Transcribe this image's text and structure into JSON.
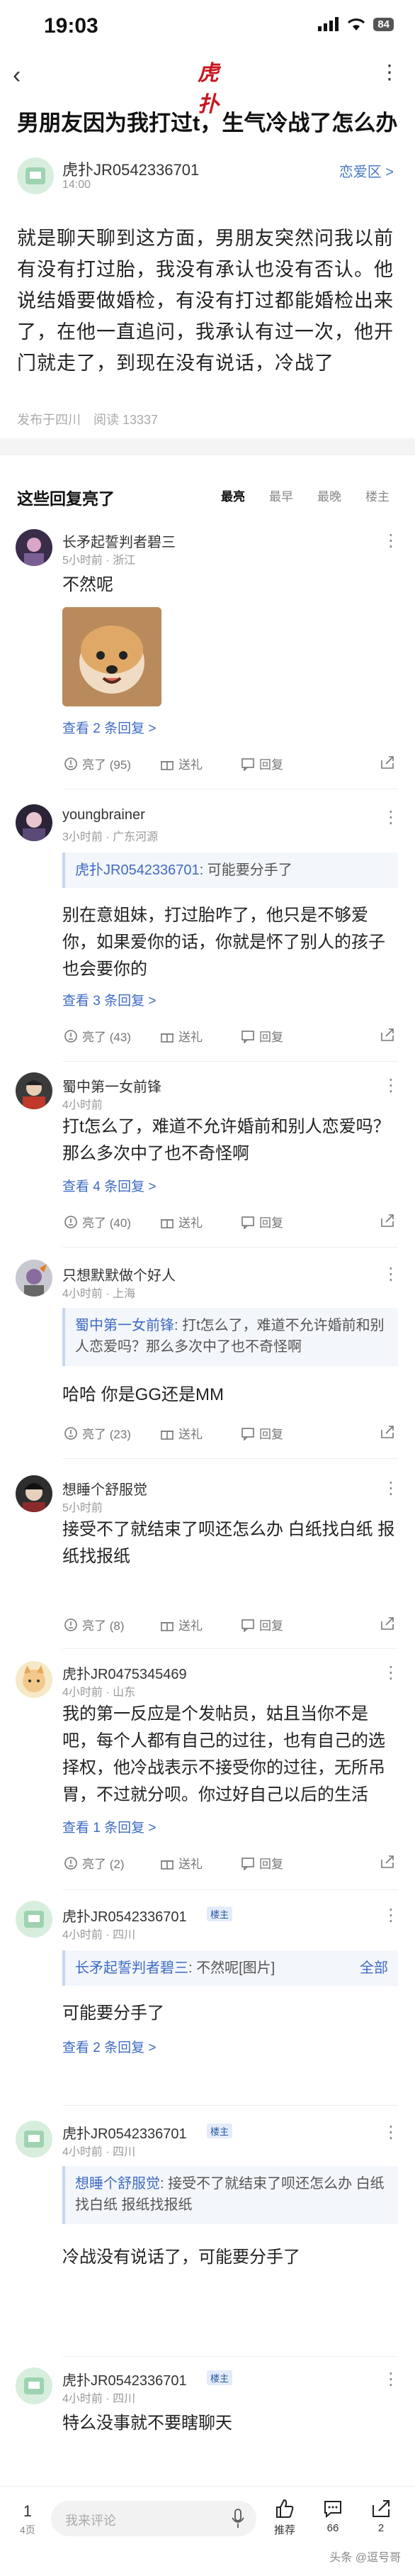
{
  "status_bar": {
    "time": "19:03",
    "battery": "84"
  },
  "nav": {
    "back_glyph": "‹",
    "logo_text": "虎扑",
    "more_glyph": "⋮",
    "brand_color": "#c8161d"
  },
  "post": {
    "title": "男朋友因为我打过t，生气冷战了怎么办",
    "author": "虎扑JR0542336701",
    "time": "14:00",
    "board": "恋爱区 >",
    "body": "就是聊天聊到这方面，男朋友突然问我以前有没有打过胎，我没有承认也没有否认。他说结婚要做婚检，有没有打过都能婚检出来了，在他一直追问，我承认有过一次，他开门就走了，到现在没有说话，冷战了",
    "meta": "发布于四川　阅读 13337"
  },
  "replies": {
    "section_title": "这些回复亮了",
    "sort": [
      "最亮",
      "最早",
      "最晚",
      "楼主"
    ]
  },
  "comments": [
    {
      "name": "长矛起誓判者碧三",
      "meta": "5小时前 · 浙江",
      "text": "不然呢",
      "link": "查看 2 条回复 >",
      "light": "亮了 (95)",
      "gift": "送礼",
      "reply": "回复"
    },
    {
      "name": "youngbrainer",
      "meta": "3小时前 · 广东河源",
      "quote_name": "虎扑JR0542336701",
      "quote_text": ": 可能要分手了",
      "text": "别在意姐妹，打过胎咋了，他只是不够爱你，如果爱你的话，你就是怀了别人的孩子也会要你的",
      "link": "查看 3 条回复 >",
      "light": "亮了 (43)",
      "gift": "送礼",
      "reply": "回复"
    },
    {
      "name": "蜀中第一女前锋",
      "meta": "4小时前",
      "text": "打t怎么了，难道不允许婚前和别人恋爱吗？那么多次中了也不奇怪啊",
      "link": "查看 4 条回复 >",
      "light": "亮了 (40)",
      "gift": "送礼",
      "reply": "回复"
    },
    {
      "name": "只想默默做个好人",
      "meta": "4小时前 · 上海",
      "quote_name": "蜀中第一女前锋",
      "quote_text": ": 打t怎么了，难道不允许婚前和别人恋爱吗？那么多次中了也不奇怪啊",
      "text": "哈哈 你是GG还是MM",
      "light": "亮了 (23)",
      "gift": "送礼",
      "reply": "回复"
    },
    {
      "name": "想睡个舒服觉",
      "meta": "5小时前",
      "text": "接受不了就结束了呗还怎么办 白纸找白纸 报纸找报纸",
      "light": "亮了 (8)",
      "gift": "送礼",
      "reply": "回复"
    },
    {
      "name": "虎扑JR0475345469",
      "meta": "4小时前 · 山东",
      "text": "我的第一反应是个发帖员，姑且当你不是吧，每个人都有自己的过往，也有自己的选择权，他冷战表示不接受你的过往，无所吊胃，不过就分呗。你过好自己以后的生活",
      "link": "查看 1 条回复 >",
      "light": "亮了 (2)",
      "gift": "送礼",
      "reply": "回复"
    },
    {
      "name": "虎扑JR0542336701",
      "badge": "楼主",
      "meta": "4小时前 · 四川",
      "quote_name": "长矛起誓判者碧三",
      "quote_text": ": 不然呢[图片]",
      "quote_all": "全部",
      "text": "可能要分手了",
      "link": "查看 2 条回复 >"
    },
    {
      "name": "虎扑JR0542336701",
      "badge": "楼主",
      "meta": "4小时前 · 四川",
      "quote_name": "想睡个舒服觉",
      "quote_text": ": 接受不了就结束了呗还怎么办 白纸找白纸 报纸找报纸",
      "text": "冷战没有说话了，可能要分手了"
    },
    {
      "name": "虎扑JR0542336701",
      "badge": "楼主",
      "meta": "4小时前 · 四川",
      "text": "特么没事就不要瞎聊天"
    }
  ],
  "bottom_bar": {
    "page": "1",
    "page_total": "4页",
    "placeholder": "我来评论",
    "recommend": "推荐",
    "comments": "66",
    "shares": "2"
  },
  "watermark": "头条 @逗号哥"
}
